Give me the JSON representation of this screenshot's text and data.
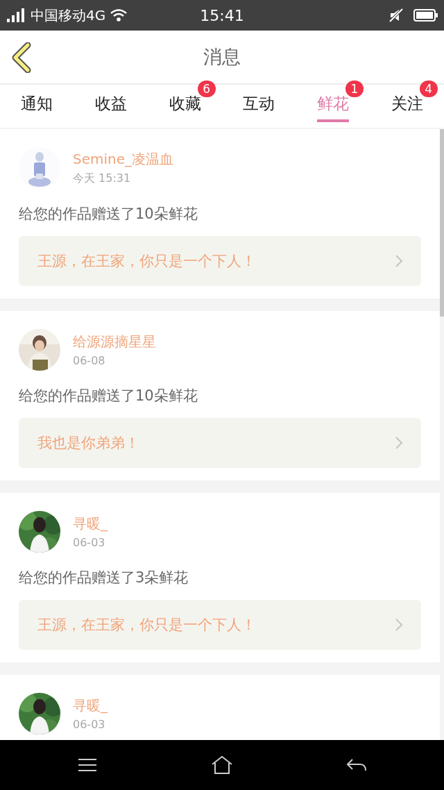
{
  "status_bar": {
    "carrier": "中国移动4G",
    "time": "15:41"
  },
  "header": {
    "title": "消息"
  },
  "tabs": [
    {
      "label": "通知",
      "selected": false
    },
    {
      "label": "收益",
      "selected": false
    },
    {
      "label": "收藏",
      "selected": false,
      "badge": "6"
    },
    {
      "label": "互动",
      "selected": false
    },
    {
      "label": "鲜花",
      "selected": true,
      "badge": "1"
    },
    {
      "label": "关注",
      "selected": false,
      "badge": "4"
    }
  ],
  "messages": [
    {
      "name": "Semine_凌温血",
      "time": "今天 15:31",
      "text": "给您的作品赠送了10朵鲜花",
      "quote": "王源，在王家，你只是一个下人！"
    },
    {
      "name": "给源源摘星星",
      "time": "06-08",
      "text": "给您的作品赠送了10朵鲜花",
      "quote": "我也是你弟弟！"
    },
    {
      "name": "寻暖_",
      "time": "06-03",
      "text": "给您的作品赠送了3朵鲜花",
      "quote": "王源，在王家，你只是一个下人！"
    },
    {
      "name": "寻暖_",
      "time": "06-03"
    }
  ]
}
